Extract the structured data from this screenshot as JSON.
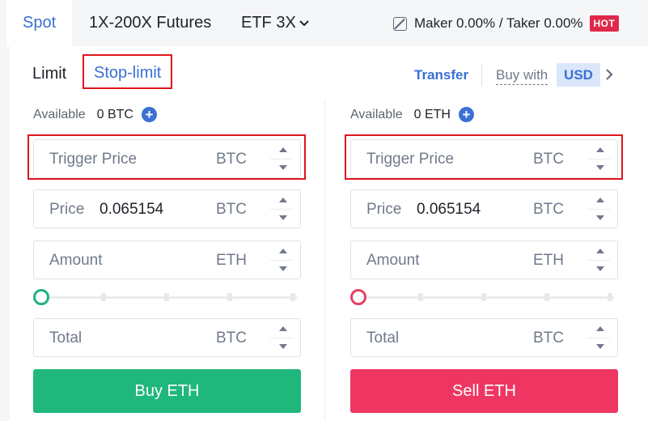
{
  "market_tabs": {
    "spot": "Spot",
    "futures": "1X-200X Futures",
    "etf": "ETF 3X"
  },
  "fees": {
    "text": "Maker 0.00% / Taker 0.00%",
    "badge": "HOT"
  },
  "order_types": {
    "limit": "Limit",
    "stop_limit": "Stop-limit",
    "selected": "Stop-limit"
  },
  "actions": {
    "transfer": "Transfer",
    "buy_with": "Buy with",
    "currency": "USD"
  },
  "buy": {
    "available_label": "Available",
    "available_value": "0 BTC",
    "trigger_price": {
      "placeholder": "Trigger Price",
      "unit": "BTC"
    },
    "price": {
      "label": "Price",
      "value": "0.065154",
      "unit": "BTC"
    },
    "amount": {
      "placeholder": "Amount",
      "unit": "ETH"
    },
    "slider_percent": 0,
    "total": {
      "placeholder": "Total",
      "unit": "BTC"
    },
    "button": "Buy ETH"
  },
  "sell": {
    "available_label": "Available",
    "available_value": "0 ETH",
    "trigger_price": {
      "placeholder": "Trigger Price",
      "unit": "BTC"
    },
    "price": {
      "label": "Price",
      "value": "0.065154",
      "unit": "BTC"
    },
    "amount": {
      "placeholder": "Amount",
      "unit": "ETH"
    },
    "slider_percent": 0,
    "total": {
      "placeholder": "Total",
      "unit": "BTC"
    },
    "button": "Sell ETH"
  },
  "colors": {
    "accent": "#3a70d4",
    "buy": "#20b77d",
    "sell": "#ef3662",
    "highlight": "#e0141c"
  }
}
